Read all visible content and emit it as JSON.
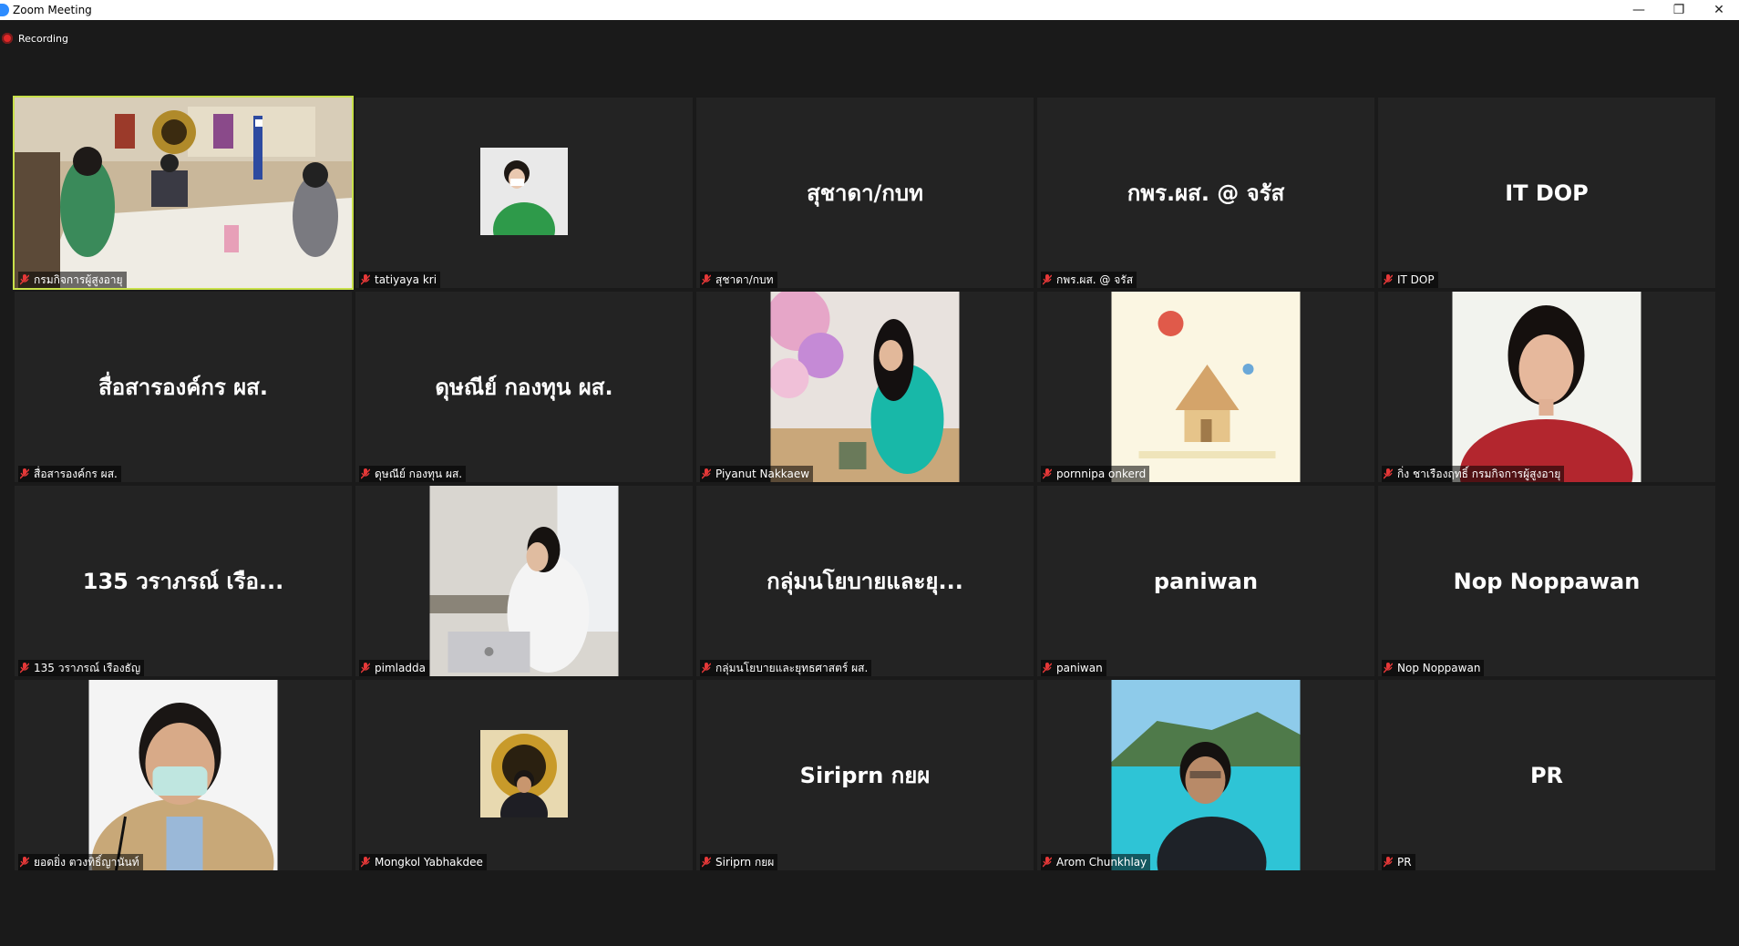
{
  "window": {
    "title": "Zoom Meeting"
  },
  "recording": {
    "label": "Recording"
  },
  "tiles": [
    {
      "name": "กรมกิจการผู้สูงอายุ",
      "display": "",
      "kind": "video-room",
      "active": true
    },
    {
      "name": "tatiyaya kri",
      "display": "",
      "kind": "small-photo-green"
    },
    {
      "name": "สุชาดา/กบท",
      "display": "สุชาดา/กบท",
      "kind": "text"
    },
    {
      "name": "กพร.ผส. @ จรัส",
      "display": "กพร.ผส. @ จรัส",
      "kind": "text"
    },
    {
      "name": "IT DOP",
      "display": "IT DOP",
      "kind": "text"
    },
    {
      "name": "สื่อสารองค์กร ผส.",
      "display": "สื่อสารองค์กร ผส.",
      "kind": "text"
    },
    {
      "name": "ดุษณีย์ กองทุน ผส.",
      "display": "ดุษณีย์ กองทุน ผส.",
      "kind": "text"
    },
    {
      "name": "Piyanut Nakkaew",
      "display": "",
      "kind": "photo-flowers"
    },
    {
      "name": "pornnipa onkerd",
      "display": "",
      "kind": "photo-house"
    },
    {
      "name": "กิ่ง ชาเรืองฤทธิ์ กรมกิจการผู้สูงอายุ",
      "display": "",
      "kind": "photo-woman-red"
    },
    {
      "name": "135 วราภรณ์ เรืองธัญ",
      "display": "135 วราภรณ์ เรือ...",
      "kind": "text"
    },
    {
      "name": "pimladda",
      "display": "",
      "kind": "photo-office"
    },
    {
      "name": "กลุ่มนโยบายและยุทธศาสตร์ ผส.",
      "display": "กลุ่มนโยบายและยุ...",
      "kind": "text"
    },
    {
      "name": "paniwan",
      "display": "paniwan",
      "kind": "text"
    },
    {
      "name": "Nop Noppawan",
      "display": "Nop Noppawan",
      "kind": "text"
    },
    {
      "name": "ยอดยิ่ง ตวงทิธิ์ญานันท์",
      "display": "",
      "kind": "photo-man-mask"
    },
    {
      "name": "Mongkol Yabhakdee",
      "display": "",
      "kind": "small-photo-emblem"
    },
    {
      "name": "Siriprn กยผ",
      "display": "Siriprn กยผ",
      "kind": "text"
    },
    {
      "name": "Arom Chunkhlay",
      "display": "",
      "kind": "photo-sea"
    },
    {
      "name": "PR",
      "display": "PR",
      "kind": "text"
    }
  ]
}
